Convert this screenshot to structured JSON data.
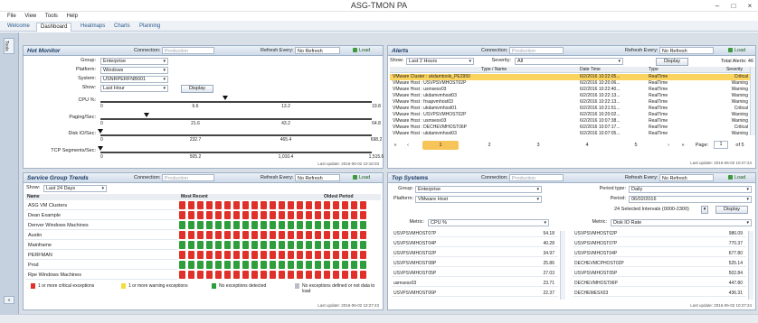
{
  "window": {
    "title": "ASG-TMON PA",
    "minimize": "–",
    "restore": "□",
    "close": "×"
  },
  "menu": [
    "File",
    "View",
    "Tools",
    "Help"
  ],
  "tabs": [
    "Welcome",
    "Dashboard",
    "Heatmaps",
    "Charts",
    "Planning"
  ],
  "side_strip": {
    "tab_label": "Tools"
  },
  "common": {
    "connection_label": "Connection:",
    "connection_value": "Production",
    "refresh_label": "Refresh Every:",
    "refresh_value": "No Refresh",
    "load_label": "Load",
    "display_label": "Display"
  },
  "hot_monitor": {
    "title": "Hot Monitor",
    "fields": [
      {
        "label": "Group:",
        "value": "Enterprise"
      },
      {
        "label": "Platform:",
        "value": "Windows"
      },
      {
        "label": "System:",
        "value": "USNRPERFNB001"
      },
      {
        "label": "Show:",
        "value": "Last Hour"
      }
    ],
    "sliders": [
      {
        "label": "CPU %:",
        "ticks": [
          "0",
          "6.6",
          "13.2",
          "19.8"
        ],
        "position": 0.46
      },
      {
        "label": "Paging/Sec:",
        "ticks": [
          "0",
          "21.6",
          "43.2",
          "64.8"
        ],
        "position": 0.17
      },
      {
        "label": "Disk IO/Sec:",
        "ticks": [
          "0",
          "232.7",
          "465.4",
          "698.2"
        ],
        "position": 0.0
      },
      {
        "label": "TCP Segments/Sec:",
        "ticks": [
          "0",
          "505.2",
          "1,010.4",
          "1,515.6"
        ],
        "position": 0.0
      }
    ],
    "last_update": "Last update: 2016-06-02 10:16:03"
  },
  "alerts": {
    "title": "Alerts",
    "show_label": "Show:",
    "show_value": "Last 2 Hours",
    "severity_label": "Severity:",
    "severity_value": "All",
    "total": "Total Alerts: 46",
    "columns": [
      "Type / Name",
      "Date Time",
      "Type",
      "Severity"
    ],
    "rows": [
      [
        "VMware Cluster : ukdamtools_PE2950",
        "6/2/2016 10:22:05...",
        "RealTime",
        "Critical"
      ],
      [
        "VMware Host : USVPSVMHOST02P",
        "6/2/2016 10:20:06...",
        "RealTime",
        "Warning"
      ],
      [
        "VMware Host : usmsesx03",
        "6/2/2016 10:22:40...",
        "RealTime",
        "Warning"
      ],
      [
        "VMware Host : ukdamvmhost03",
        "6/2/2016 10:22:13...",
        "RealTime",
        "Warning"
      ],
      [
        "VMware Host : frsapvmhost03",
        "6/2/2016 10:22:13...",
        "RealTime",
        "Warning"
      ],
      [
        "VMware Host : ukdamvmhost01",
        "6/2/2016 10:21:51...",
        "RealTime",
        "Critical"
      ],
      [
        "VMware Host : USVPSVMHOST02P",
        "6/2/2016 10:20:02...",
        "RealTime",
        "Warning"
      ],
      [
        "VMware Host : usmsesx03",
        "6/2/2016 10:07:38...",
        "RealTime",
        "Warning"
      ],
      [
        "VMware Host : DECHEVMHOST06P",
        "6/2/2016 10:07:17...",
        "RealTime",
        "Critical"
      ],
      [
        "VMware Host : ukdamvmhost03",
        "6/2/2016 10:07:05...",
        "RealTime",
        "Warning"
      ]
    ],
    "pager": {
      "first": "«",
      "prev": "‹",
      "pages": [
        "1",
        "2",
        "3",
        "4",
        "5"
      ],
      "next": "›",
      "last": "»",
      "page_label": "Page:",
      "page_value": "1",
      "of_label": "of 5"
    },
    "last_update": "Last update: 2016-06-02 10:27:24"
  },
  "service_group": {
    "title": "Service Group Trends",
    "show_label": "Show:",
    "show_value": "Last 24 Days",
    "columns": [
      "Name",
      "Most Recent",
      "Oldest Period"
    ],
    "rows": [
      {
        "name": "ASG VM Clusters",
        "colors": "rrrrrrrrrrrrrrrrrrrrr"
      },
      {
        "name": "Dean Example",
        "colors": "rrrrrrrrrrrrrrrrrrrrr"
      },
      {
        "name": "Denver Windows Machines",
        "colors": "ggggggggggggggggggggg"
      },
      {
        "name": "Austin",
        "colors": "rrrrrrrrrrrrrrrrrrrrr"
      },
      {
        "name": "Mainframe",
        "colors": "ggggggggggggggggggggg"
      },
      {
        "name": "PERFMAN",
        "colors": "rrrrrrrrrrrrrrrrrrrrr"
      },
      {
        "name": "Prod",
        "colors": "ggggggggggggggggggggg"
      },
      {
        "name": "Rpe Windows Machines",
        "colors": "rrrrrrrrrrrrrrrrrrrrr"
      }
    ],
    "legend": [
      {
        "color": "#e0302a",
        "text": "1 or more critical exceptions"
      },
      {
        "color": "#f2de3b",
        "text": "1 or more warning exceptions"
      },
      {
        "color": "#2e9e3c",
        "text": "No exceptions detected"
      },
      {
        "color": "#b9bec6",
        "text": "No exceptions defined or not data to load"
      }
    ],
    "last_update": "Last update: 2016-06-02 10:27:43"
  },
  "top_systems": {
    "title": "Top Systems",
    "group_label": "Group:",
    "group_value": "Enterprise",
    "platform_label": "Platform:",
    "platform_value": "VMware Host",
    "period_type_label": "Period type:",
    "period_type_value": "Daily",
    "period_label": "Period:",
    "period_value": "06/02/2016",
    "interval_text": "24 Selected Intervals (0000-2300)",
    "left_metric_label": "Metric:",
    "left_metric_value": "CPU %",
    "right_metric_label": "Metric:",
    "right_metric_value": "Disk IO Rate",
    "left_rows": [
      [
        "USVPSVMHOST07P",
        "54.18"
      ],
      [
        "USVPSVMHOST04P",
        "40.28"
      ],
      [
        "USVPSVMHOST02P",
        "34.97"
      ],
      [
        "USVPSVMHOST08P",
        "25.86"
      ],
      [
        "USVPSVMHOST05P",
        "27.03"
      ],
      [
        "usmsesx03",
        "23.71"
      ],
      [
        "USVPSVMHOST06P",
        "22.37"
      ]
    ],
    "right_rows": [
      [
        "USVPSVMHOST02P",
        "986.09"
      ],
      [
        "USVPSVMHOST07P",
        "770.37"
      ],
      [
        "USVPSVMHOST04P",
        "677.80"
      ],
      [
        "DECHEVMCPHOST02P",
        "525.14"
      ],
      [
        "USVPSVMHOST05P",
        "502.84"
      ],
      [
        "DECHEVMHOST06P",
        "447.80"
      ],
      [
        "DECHEMESX03",
        "436.31"
      ]
    ],
    "last_update": "Last update: 2016-06-02 10:27:24"
  },
  "status": {
    "text": ""
  }
}
